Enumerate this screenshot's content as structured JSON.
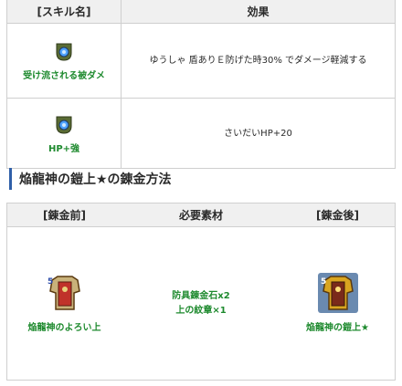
{
  "skill_table": {
    "header_skill": "[スキル名]",
    "header_effect": "効果",
    "rows": [
      {
        "skill_name": "受け流される被ダメ",
        "icon": "skill-orb-icon",
        "effect": "ゆうしゃ 盾ありＥ防げた時30% でダメージ軽減する"
      },
      {
        "skill_name": "HP+強",
        "icon": "skill-orb-icon",
        "effect": "さいだいHP+20"
      }
    ]
  },
  "section_title": "焔龍神の鎧上★の錬金方法",
  "recipe_table": {
    "header_base": "[錬金前]",
    "header_materials": "必要素材",
    "header_result": "[錬金後]",
    "base_item_name": "焔龍神のよろい上",
    "materials": [
      "防具錬金石x2",
      "上の紋章×1"
    ],
    "result_item_name": "焔龍神の鎧上★",
    "base_item_icon": "armor-red-icon",
    "result_item_icon": "armor-gold-icon"
  },
  "colors": {
    "accent": "#2f5fa8",
    "green_text": "#1e8a2e",
    "header_bg": "#f0f0f0"
  }
}
